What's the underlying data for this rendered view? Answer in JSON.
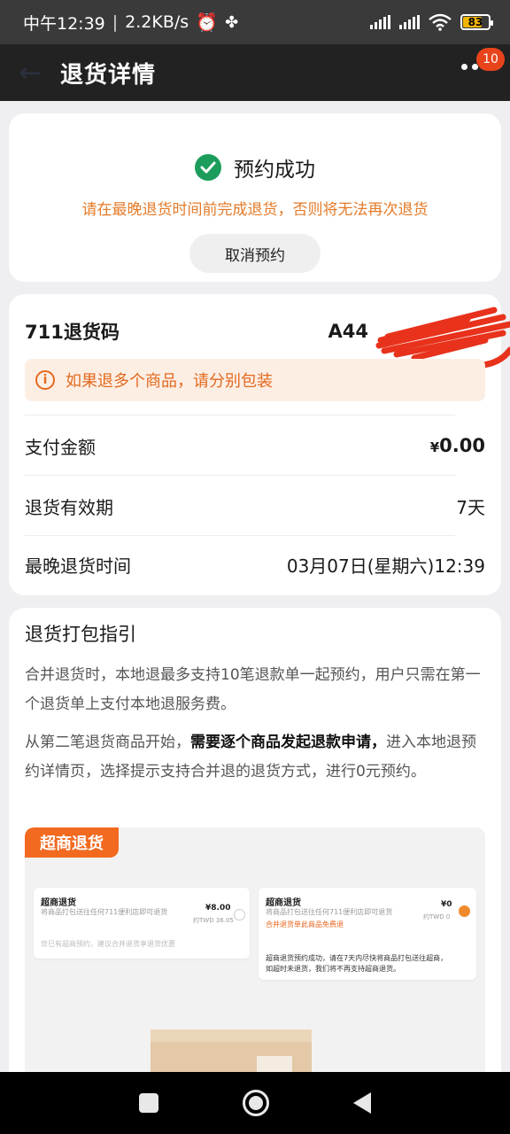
{
  "status_bar": {
    "time": "中午12:39",
    "speed": "2.2KB/s",
    "battery": "83"
  },
  "nav": {
    "title": "退货详情",
    "badge": "10"
  },
  "success": {
    "title": "预约成功",
    "warning": "请在最晚退货时间前完成退货，否则将无法再次退货",
    "cancel_label": "取消预约"
  },
  "code_card": {
    "label": "711退货码",
    "value": "A44",
    "tip": "如果退多个商品，请分别包装",
    "rows": [
      {
        "label": "支付金额",
        "currency": "¥",
        "value": "0.00"
      },
      {
        "label": "退货有效期",
        "value": "7天"
      },
      {
        "label": "最晚退货时间",
        "value": "03月07日(星期六)12:39"
      }
    ]
  },
  "guide": {
    "title": "退货打包指引",
    "para1": "合并退货时，本地退最多支持10笔退款单一起预约，用户只需在第一个退货单上支付本地退服务费。",
    "para2_prefix": "从第二笔退货商品开始，",
    "para2_bold": "需要逐个商品发起退款申请，",
    "para2_suffix": "进入本地退预约详情页，选择提示支持合并退的退货方式，进行0元预约。",
    "image": {
      "tag": "超商退货",
      "left_card": {
        "title": "超商退货",
        "sub": "将商品打包送往任何711便利店即可退货",
        "price": "¥8.00",
        "twd": "约TWD 36.05",
        "note": "您已有超商预约，建议合并退货享退货优惠"
      },
      "right_card": {
        "title": "超商退货",
        "sub": "将商品打包送往任何711便利店即可退货",
        "price": "¥0",
        "twd": "约TWD 0",
        "orange": "合并退货单此商品免费退",
        "note1": "超商退货预约成功，请在7天内尽快将商品打包送往超商，",
        "note2": "如超时未退货，我们将不再支持超商退货。"
      }
    }
  },
  "colors": {
    "accent_orange": "#e37b2a",
    "success_green": "#1c9d5b",
    "badge_red": "#e8441c",
    "tag_orange": "#f26a20"
  }
}
